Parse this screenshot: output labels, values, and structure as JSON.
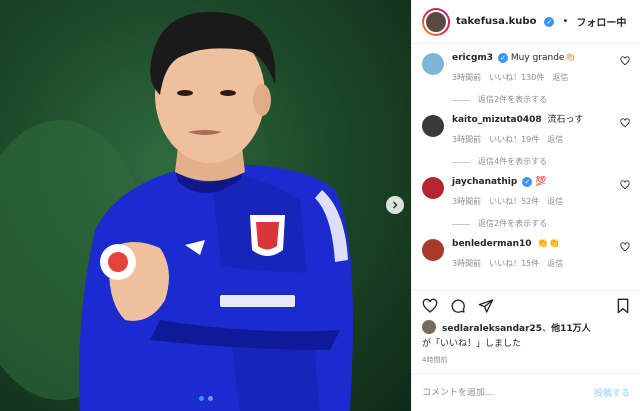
{
  "header": {
    "username": "takefusa.kubo",
    "separator": "•",
    "follow_status": "フォロー中"
  },
  "comments": [
    {
      "username": "ericgm3",
      "verified": true,
      "text": "Muy grande👏🏻",
      "time": "3時間前",
      "likes": "いいね！130件",
      "reply": "返信",
      "replies": "返信2件を表示する",
      "avatar_color": "#7fb6d8"
    },
    {
      "username": "kaito_mizuta0408",
      "verified": false,
      "text": "流石っす",
      "time": "3時間前",
      "likes": "いいね！19件",
      "reply": "返信",
      "replies": "返信4件を表示する",
      "avatar_color": "#3a3a3a"
    },
    {
      "username": "jaychanathip",
      "verified": true,
      "text": "💯",
      "time": "3時間前",
      "likes": "いいね！52件",
      "reply": "返信",
      "replies": "返信2件を表示する",
      "avatar_color": "#b3262f"
    },
    {
      "username": "benlederman10",
      "verified": false,
      "text": "👏👏",
      "time": "3時間前",
      "likes": "いいね！15件",
      "reply": "返信",
      "replies": "",
      "avatar_color": "#a83a2a"
    }
  ],
  "likes": {
    "user": "sedlaraleksandar25",
    "connector": "、",
    "others": "他11万人",
    "suffix": "が「いいね！」しました"
  },
  "timestamp": "4時間前",
  "composer": {
    "placeholder": "コメントを追加...",
    "post_label": "投稿する"
  },
  "colors": {
    "accent": "#3897f0",
    "muted": "#8e8e8e",
    "jersey": "#1b2bd0"
  },
  "icons": [
    "chevron-right-icon",
    "heart-icon",
    "comment-icon",
    "share-icon",
    "bookmark-icon",
    "verified-icon"
  ]
}
